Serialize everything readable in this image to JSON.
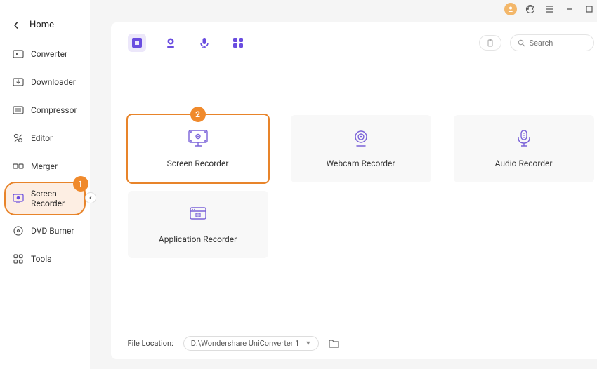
{
  "home_label": "Home",
  "sidebar": {
    "items": [
      {
        "label": "Converter"
      },
      {
        "label": "Downloader"
      },
      {
        "label": "Compressor"
      },
      {
        "label": "Editor"
      },
      {
        "label": "Merger"
      },
      {
        "label": "Screen Recorder"
      },
      {
        "label": "DVD Burner"
      },
      {
        "label": "Tools"
      }
    ]
  },
  "callouts": {
    "one": "1",
    "two": "2"
  },
  "search": {
    "placeholder": "Search"
  },
  "cards": {
    "screen": "Screen Recorder",
    "webcam": "Webcam Recorder",
    "audio": "Audio Recorder",
    "app": "Application Recorder"
  },
  "footer": {
    "label": "File Location:",
    "path": "D:\\Wondershare UniConverter 1"
  }
}
